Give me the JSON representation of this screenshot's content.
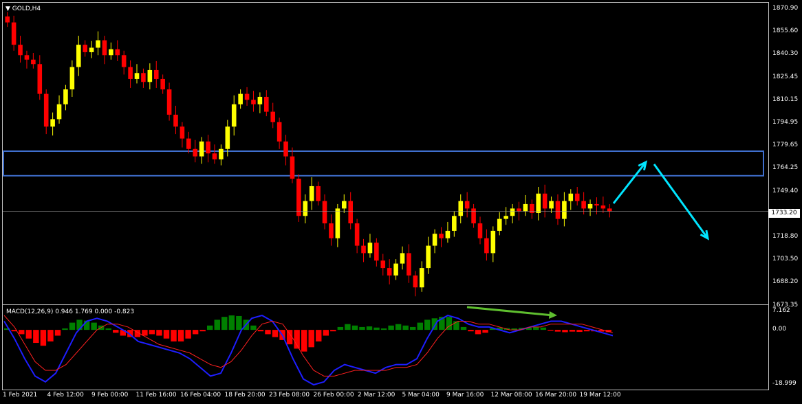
{
  "window": {
    "symbol_title": "GOLD,H4",
    "menu_icon": "triangle-down-icon"
  },
  "price_axis": {
    "labels": [
      "1870.90",
      "1855.60",
      "1840.30",
      "1825.45",
      "1810.15",
      "1794.95",
      "1779.65",
      "1764.25",
      "1749.40",
      "1733.20",
      "1718.80",
      "1703.50",
      "1688.20",
      "1673.35"
    ],
    "current_price": "1733.20"
  },
  "macd": {
    "title": "MACD(12,26,9) 0.946 1.769 0.000 -0.823",
    "axis_labels": [
      "7.162",
      "0.00",
      "-18.999"
    ]
  },
  "time_axis": {
    "labels": [
      "1 Feb 2021",
      "4 Feb 12:00",
      "9 Feb 00:00",
      "11 Feb 16:00",
      "16 Feb 04:00",
      "18 Feb 20:00",
      "23 Feb 08:00",
      "26 Feb 00:00",
      "2 Mar 12:00",
      "5 Mar 04:00",
      "9 Mar 16:00",
      "12 Mar 08:00",
      "16 Mar 20:00",
      "19 Mar 12:00"
    ]
  },
  "colors": {
    "bull": "#ffff00",
    "bear": "#ff0000",
    "zone": "#3f6fce",
    "arrow": "#00e5ff",
    "macd_pos": "#008000",
    "macd_neg": "#ff0000",
    "macd_line": "#1e1eff",
    "signal_line": "#ff2020",
    "divergence": "#5fbf2f"
  },
  "chart_data": {
    "type": "candlestick",
    "ylim": [
      1673.35,
      1870.9
    ],
    "close_path": [
      1860,
      1845,
      1838,
      1835,
      1832,
      1812,
      1790,
      1795,
      1805,
      1815,
      1830,
      1845,
      1840,
      1843,
      1848,
      1838,
      1842,
      1838,
      1830,
      1822,
      1826,
      1820,
      1828,
      1822,
      1815,
      1798,
      1790,
      1782,
      1775,
      1770,
      1780,
      1772,
      1768,
      1775,
      1790,
      1805,
      1812,
      1808,
      1805,
      1810,
      1800,
      1793,
      1780,
      1770,
      1755,
      1730,
      1740,
      1750,
      1740,
      1725,
      1715,
      1735,
      1740,
      1725,
      1710,
      1705,
      1712,
      1700,
      1695,
      1690,
      1698,
      1705,
      1690,
      1682,
      1695,
      1710,
      1718,
      1715,
      1720,
      1730,
      1740,
      1735,
      1725,
      1715,
      1705,
      1720,
      1728,
      1730,
      1735,
      1733,
      1738,
      1732,
      1745,
      1735,
      1740,
      1728,
      1740,
      1745,
      1740,
      1735,
      1738,
      1737,
      1735,
      1733
    ],
    "macd_hist": [
      0.5,
      -0.5,
      -1.5,
      -3.0,
      -4.5,
      -5.5,
      -4.0,
      -2.0,
      0.5,
      2.5,
      3.5,
      3.2,
      2.5,
      1.5,
      0.5,
      -1.0,
      -2.0,
      -2.5,
      -2.5,
      -2.0,
      -1.5,
      -2.0,
      -3.0,
      -4.0,
      -4.0,
      -3.0,
      -1.5,
      -0.5,
      1.5,
      3.5,
      4.5,
      5.0,
      4.8,
      3.5,
      1.5,
      -0.5,
      -1.5,
      -2.5,
      -3.5,
      -5.0,
      -6.5,
      -7.5,
      -6.0,
      -4.0,
      -2.0,
      -0.5,
      1.0,
      2.0,
      1.5,
      1.0,
      1.2,
      0.8,
      0.5,
      1.5,
      2.0,
      1.5,
      1.0,
      2.5,
      3.5,
      4.0,
      4.5,
      4.5,
      3.0,
      1.0,
      -0.5,
      -1.5,
      -1.0,
      0.5,
      0.8,
      0.6,
      0.5,
      0.7,
      0.8,
      1.0,
      0.8,
      -0.3,
      -0.6,
      -0.8,
      -0.6,
      -0.7,
      -0.5,
      -0.5,
      -0.6,
      -0.8
    ],
    "macd_line": [
      3,
      -3,
      -10,
      -16,
      -18,
      -15,
      -8,
      -1,
      3,
      4,
      3,
      1,
      -1,
      -4,
      -5,
      -6,
      -7,
      -8,
      -10,
      -13,
      -16,
      -15,
      -8,
      0,
      4,
      5,
      3,
      -2,
      -10,
      -17,
      -19,
      -18,
      -14,
      -12,
      -13,
      -14,
      -15,
      -13,
      -12,
      -12,
      -10,
      -3,
      3,
      5,
      4,
      2,
      1,
      1,
      0,
      -1,
      0,
      1,
      2,
      3,
      3,
      2,
      1,
      0,
      -1,
      -2
    ],
    "signal_line": [
      5,
      1,
      -5,
      -11,
      -14,
      -14,
      -12,
      -8,
      -4,
      0,
      2,
      2,
      1,
      -1,
      -3,
      -5,
      -6,
      -7,
      -8,
      -10,
      -12,
      -13,
      -11,
      -7,
      -2,
      2,
      3,
      2,
      -3,
      -9,
      -14,
      -16,
      -16,
      -15,
      -14,
      -14,
      -14,
      -14,
      -13,
      -13,
      -12,
      -8,
      -3,
      1,
      3,
      3,
      2,
      2,
      1,
      0,
      0,
      1,
      1,
      2,
      2,
      2,
      2,
      1,
      0,
      -1
    ],
    "macd_ylim": [
      -18.999,
      7.162
    ]
  }
}
